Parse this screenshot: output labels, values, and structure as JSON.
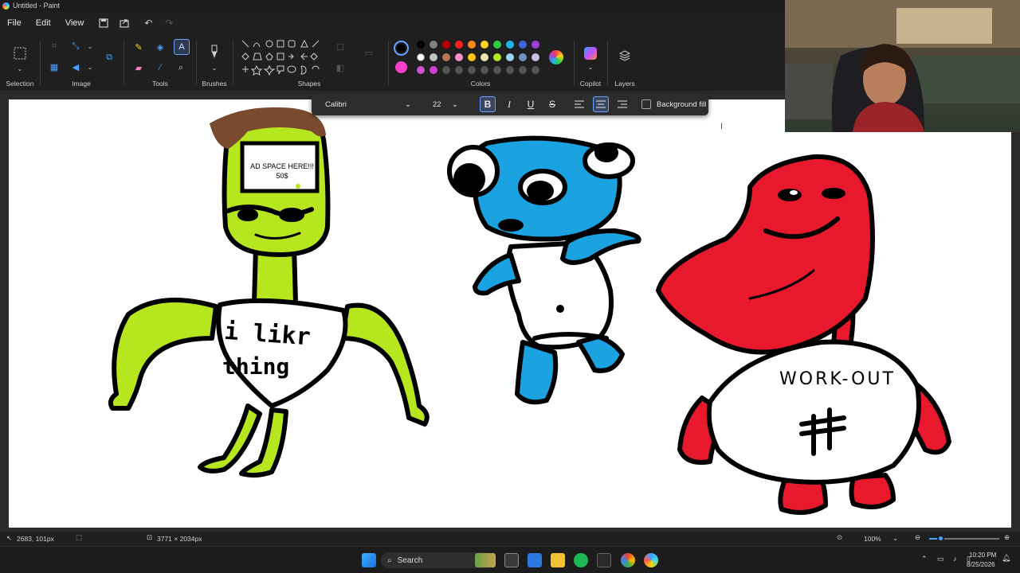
{
  "window": {
    "title": "Untitled - Paint"
  },
  "menu": {
    "file": "File",
    "edit": "Edit",
    "view": "View"
  },
  "ribbon": {
    "groups": {
      "selection": "Selection",
      "image": "Image",
      "tools": "Tools",
      "brushes": "Brushes",
      "shapes": "Shapes",
      "colors": "Colors",
      "copilot": "Copilot",
      "layers": "Layers"
    },
    "active_tool": "text",
    "primary_color": "#000000",
    "secondary_color": "#ff3ec9",
    "palette_row1": [
      "#000000",
      "#7f7f7f",
      "#c00000",
      "#ff1f1f",
      "#ff8a1f",
      "#ffd21f",
      "#2ecc40",
      "#1fb3e6",
      "#3f66e0",
      "#a33fe0"
    ],
    "palette_row2": [
      "#ffffff",
      "#c3c3c3",
      "#b97a57",
      "#ff8fc8",
      "#ffc90e",
      "#efe4b0",
      "#b5e61d",
      "#99d9ea",
      "#7092be",
      "#c8bfe7"
    ],
    "palette_row3": [
      "#d04fd0",
      "#d03fd0",
      "#555555",
      "#555555",
      "#555555",
      "#555555",
      "#555555",
      "#555555",
      "#555555",
      "#555555"
    ]
  },
  "text_toolbar": {
    "font": "Calibri",
    "size": "22",
    "bold": "B",
    "italic": "I",
    "underline": "U",
    "strike": "S",
    "background_fill": "Background fill"
  },
  "drawing": {
    "ad_line1": "AD SPACE HERE!!!",
    "ad_line2": "50$",
    "shirt_line1": "i likr",
    "shirt_line2": "thing",
    "workout": "WORK-OUT",
    "colors": {
      "green": "#b6e61d",
      "blue": "#1aa3e0",
      "red": "#e8192c",
      "brown": "#7a4a2e"
    }
  },
  "status": {
    "cursor_pos": "2683, 101px",
    "canvas_size": "3771 × 2034px",
    "zoom": "100%"
  },
  "taskbar": {
    "search": "Search",
    "time": "10:20 PM",
    "date": "8/25/2026"
  }
}
